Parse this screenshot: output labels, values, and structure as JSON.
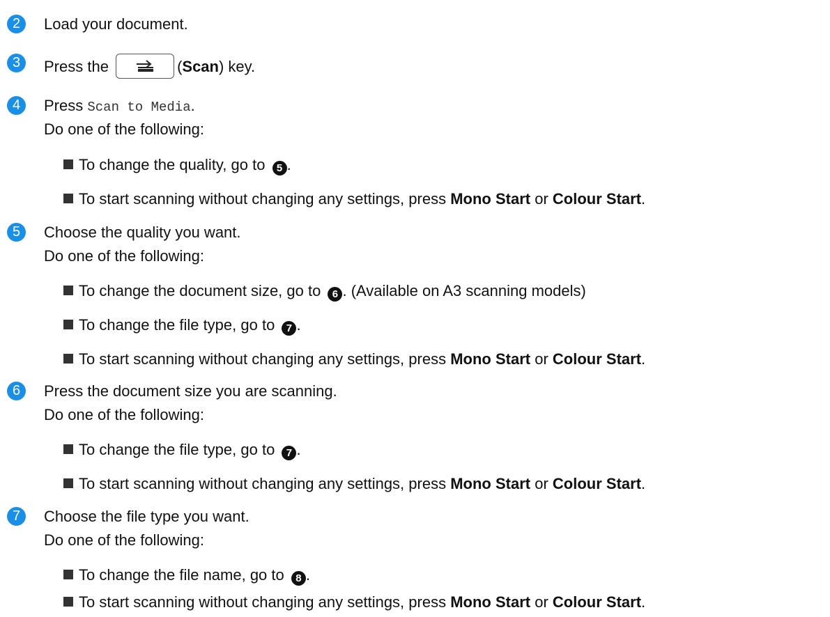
{
  "accent_color": "#1a8fe8",
  "steps": [
    {
      "num": "2",
      "text": "Load your document."
    },
    {
      "num": "3",
      "pre": "Press the",
      "key_icon": "scan-key-icon",
      "key_open": "(",
      "key_name": "Scan",
      "post": ") key."
    },
    {
      "num": "4",
      "pre": "Press",
      "mono": "Scan to Media",
      "post": ".",
      "sub": "Do one of the following:",
      "bullets": [
        {
          "text": "To change the quality, go to",
          "ref": "5",
          "after": "."
        },
        {
          "text": "To start scanning without changing any settings, press",
          "bold1": "Mono Start",
          "or": "or",
          "bold2": "Colour Start",
          "after": "."
        }
      ]
    },
    {
      "num": "5",
      "text": "Choose the quality you want.",
      "sub": "Do one of the following:",
      "bullets": [
        {
          "text": "To change the document size, go to",
          "ref": "6",
          "after": ". (Available on A3 scanning models)"
        },
        {
          "text": "To change the file type, go to",
          "ref": "7",
          "after": "."
        },
        {
          "text": "To start scanning without changing any settings, press",
          "bold1": "Mono Start",
          "or": "or",
          "bold2": "Colour Start",
          "after": "."
        }
      ]
    },
    {
      "num": "6",
      "text": "Press the document size you are scanning.",
      "sub": "Do one of the following:",
      "bullets": [
        {
          "text": "To change the file type, go to",
          "ref": "7",
          "after": "."
        },
        {
          "text": "To start scanning without changing any settings, press",
          "bold1": "Mono Start",
          "or": "or",
          "bold2": "Colour Start",
          "after": "."
        }
      ]
    },
    {
      "num": "7",
      "text": "Choose the file type you want.",
      "sub": "Do one of the following:",
      "bullets": [
        {
          "text": "To change the file name, go to",
          "ref": "8",
          "after": "."
        },
        {
          "text": "To start scanning without changing any settings, press",
          "bold1": "Mono Start",
          "or": "or",
          "bold2": "Colour Start",
          "after": "."
        }
      ]
    }
  ]
}
